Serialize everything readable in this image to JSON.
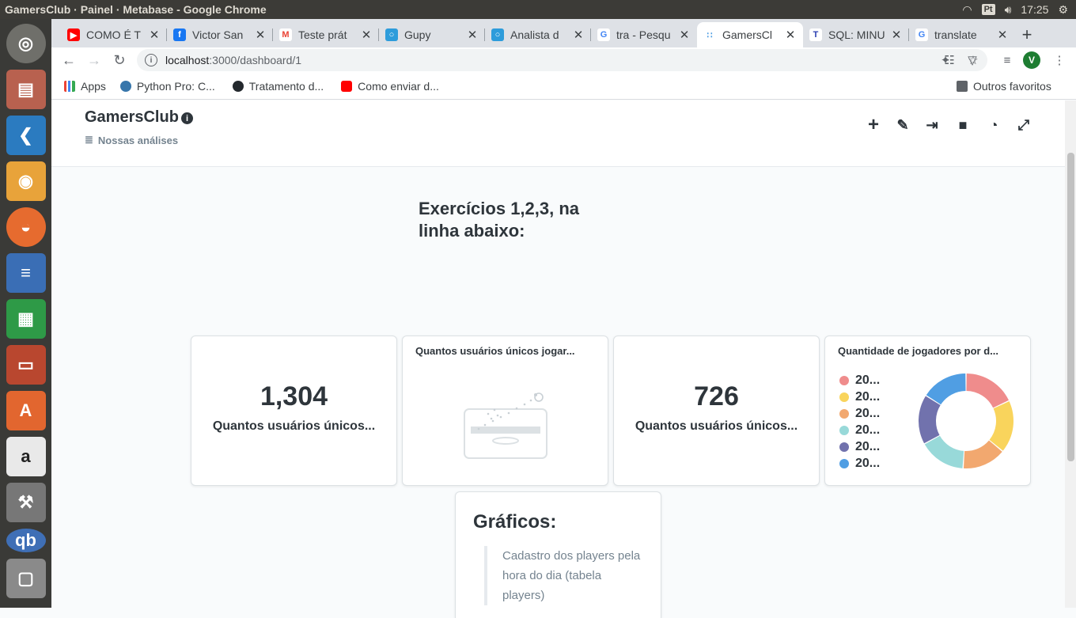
{
  "window_title": "GamersClub · Painel · Metabase - Google Chrome",
  "system_tray": {
    "keyboard": "Pt",
    "time": "17:25"
  },
  "launcher": [
    "ubuntu",
    "files",
    "vscode",
    "chrome",
    "firefox",
    "writer",
    "calc",
    "impress",
    "software-center",
    "amazon",
    "settings",
    "qbittorrent",
    "scanner"
  ],
  "tabs": [
    {
      "label": "COMO É T",
      "icon": "youtube-icon",
      "color": "#ff0000"
    },
    {
      "label": "Victor San",
      "icon": "facebook-icon",
      "color": "#1877f2"
    },
    {
      "label": "Teste prát",
      "icon": "gmail-icon",
      "color": "#ea4335"
    },
    {
      "label": "Gupy",
      "icon": "gupy-icon",
      "color": "#2d9cdb"
    },
    {
      "label": "Analista d",
      "icon": "gupy-icon",
      "color": "#2d9cdb"
    },
    {
      "label": "tra - Pesqu",
      "icon": "google-icon",
      "color": "#4285f4"
    },
    {
      "label": "GamersCl",
      "icon": "metabase-icon",
      "color": "#509ee3"
    },
    {
      "label": "SQL: MINU",
      "icon": "t-icon",
      "color": "#2a3eb1"
    },
    {
      "label": "translate",
      "icon": "google-icon",
      "color": "#4285f4"
    }
  ],
  "address": {
    "host": "localhost",
    "path": ":3000/dashboard/1"
  },
  "bookmarks": [
    {
      "label": "Apps",
      "icon": "apps-grid-icon"
    },
    {
      "label": "Python Pro: C...",
      "icon": "python-icon"
    },
    {
      "label": "Tratamento d...",
      "icon": "github-icon"
    },
    {
      "label": "Como enviar d...",
      "icon": "youtube-icon"
    }
  ],
  "other_bookmarks": "Outros favoritos",
  "dashboard": {
    "title": "GamersClub",
    "collection": "Nossas análises",
    "text_card": "Exercícios 1,2,3, na linha abaixo:",
    "cards": {
      "scalar1": {
        "value": "1,304",
        "label": "Quantos usuários únicos..."
      },
      "empty": {
        "title": "Quantos usuários únicos jogar..."
      },
      "scalar2": {
        "value": "726",
        "label": "Quantos usuários únicos..."
      },
      "pie": {
        "title": "Quantidade de jogadores por d..."
      }
    },
    "graficos": {
      "title": "Gráficos:",
      "quote": "Cadastro dos players pela hora do dia (tabela players)"
    }
  },
  "chart_data": {
    "type": "pie",
    "donut": true,
    "legend_position": "left",
    "series": [
      {
        "name": "20...",
        "value": 18.0,
        "color": "#ef8c8c"
      },
      {
        "name": "20...",
        "value": 18.0,
        "color": "#f9d45c"
      },
      {
        "name": "20...",
        "value": 15.0,
        "color": "#f2a86f"
      },
      {
        "name": "20...",
        "value": 16.0,
        "color": "#98d9d9"
      },
      {
        "name": "20...",
        "value": 17.0,
        "color": "#7172ad"
      },
      {
        "name": "20...",
        "value": 16.0,
        "color": "#509ee3"
      }
    ]
  }
}
